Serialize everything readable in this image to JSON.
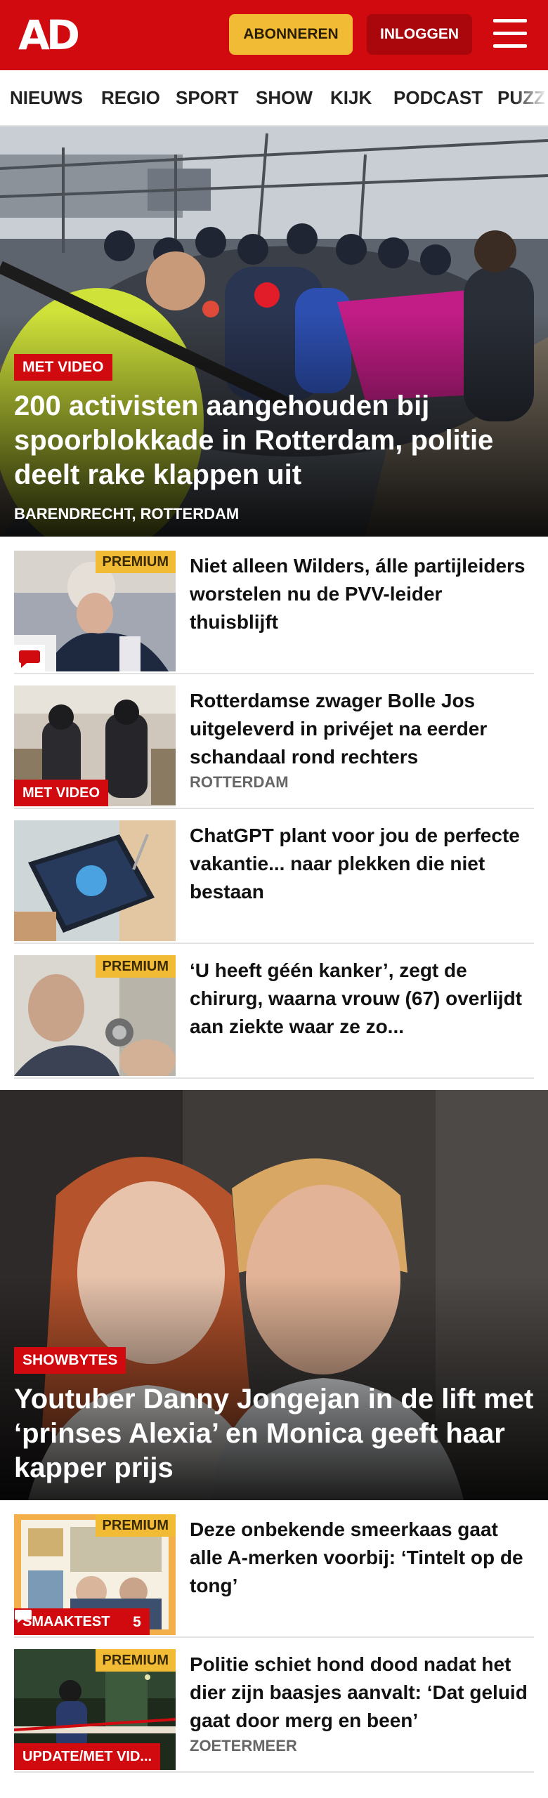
{
  "header": {
    "logo": "AD",
    "subscribe_label": "ABONNEREN",
    "login_label": "INLOGGEN"
  },
  "nav": {
    "items": [
      "NIEUWS",
      "REGIO",
      "SPORT",
      "SHOW",
      "KIJK",
      "PODCAST",
      "PUZZ"
    ]
  },
  "hero1": {
    "label": "MET VIDEO",
    "title": "200 activisten aangehouden bij spoorblokkade in Rotterdam, politie deelt rake klappen uit",
    "location": "BARENDRECHT, ROTTERDAM"
  },
  "articles1": [
    {
      "title": "Niet alleen Wilders, álle partijlei­ders worstelen nu de PVV-leider thuisblijft",
      "premium": "PREMIUM"
    },
    {
      "title": "Rotterdamse zwager Bolle Jos uitgeleverd in privéjet na eerder schandaal rond rechters",
      "category": "MET VIDEO",
      "location": "ROTTERDAM"
    },
    {
      "title": "ChatGPT plant voor jou de perfecte vakantie... naar plekken die niet bestaan"
    },
    {
      "title": "‘U heeft géén kanker’, zegt de chirurg, waarna vrouw (67) overlijdt aan ziekte waar ze zo...",
      "premium": "PREMIUM"
    }
  ],
  "hero2": {
    "label": "SHOWBYTES",
    "title": "Youtuber Danny Jongejan in de lift met ‘prinses Alexia’ en Monica geeft haar kapper prijs"
  },
  "articles2": [
    {
      "title": "Deze onbekende smeerkaas gaat alle A-merken voorbij: ‘Tintelt op de tong’",
      "premium": "PREMIUM",
      "category": "SMAAKTEST",
      "comments": "5"
    },
    {
      "title": "Politie schiet hond dood nadat het dier zijn baasjes aanvalt: ‘Dat geluid gaat door merg en been’",
      "premium": "PREMIUM",
      "category": "UPDATE/MET VID...",
      "location": "ZOETERMEER"
    }
  ],
  "colors": {
    "brand_red": "#d10a10",
    "premium_yellow": "#f2bb35",
    "login_dark_red": "#a9070c"
  },
  "icons": [
    "menu-icon",
    "comment-icon"
  ]
}
